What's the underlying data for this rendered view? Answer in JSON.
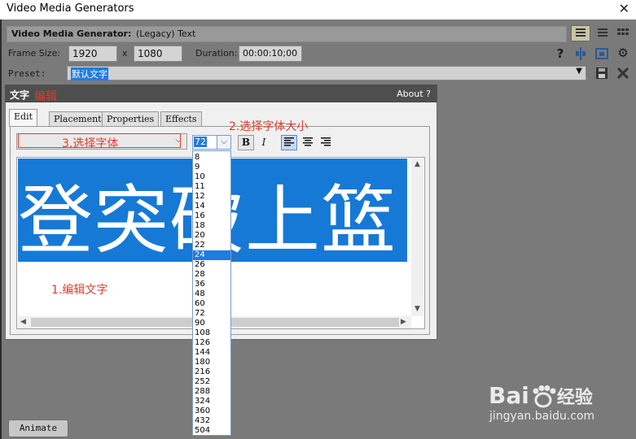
{
  "window": {
    "title": "Video Media Generators",
    "close_glyph": "✕"
  },
  "header": {
    "generator_label": "Video Media Generator:",
    "generator_name": "(Legacy) Text"
  },
  "frame": {
    "label": "Frame Size:",
    "width": "1920",
    "x": "x",
    "height": "1080",
    "duration_label": "Duration:",
    "duration": "00:00:10;00"
  },
  "preset": {
    "label": "Preset:",
    "value": "默认文字"
  },
  "panel": {
    "title": "文字",
    "about": "About",
    "help": "?"
  },
  "tabs": [
    {
      "label": "Edit"
    },
    {
      "label": "Placement"
    },
    {
      "label": "Properties"
    },
    {
      "label": "Effects"
    }
  ],
  "toolbar": {
    "font_size": "72",
    "bold": "B",
    "italic": "I"
  },
  "editor": {
    "text": "登突破上篮"
  },
  "size_options": [
    "8",
    "9",
    "10",
    "11",
    "12",
    "14",
    "16",
    "18",
    "20",
    "22",
    "24",
    "26",
    "28",
    "36",
    "48",
    "60",
    "72",
    "90",
    "108",
    "126",
    "144",
    "180",
    "216",
    "252",
    "288",
    "324",
    "360",
    "432",
    "504"
  ],
  "size_selected": "24",
  "annotations": {
    "edit": "编辑",
    "step1": "1.编辑文字",
    "step2": "2.选择字体大小",
    "step3": "3.选择字体"
  },
  "footer": {
    "animate": "Animate"
  },
  "watermark": {
    "brand": "Bai",
    "brand2": "经验",
    "url": "jingyan.baidu.com"
  },
  "colors": {
    "accent": "#1f7ce0",
    "annotation": "#e23b2d",
    "banner": "#1679d6"
  }
}
